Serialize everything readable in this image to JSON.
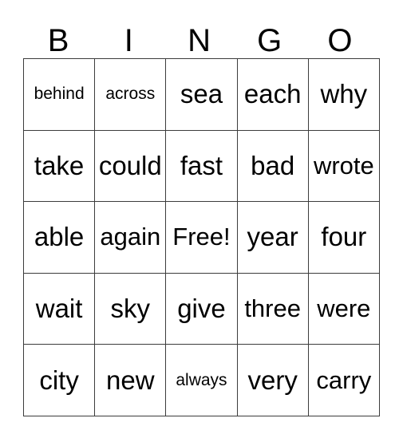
{
  "card": {
    "header_letters": [
      "B",
      "I",
      "N",
      "G",
      "O"
    ],
    "free_space_label": "Free!",
    "rows": [
      [
        {
          "text": "behind",
          "size": "small"
        },
        {
          "text": "across",
          "size": "small"
        },
        {
          "text": "sea",
          "size": "normal"
        },
        {
          "text": "each",
          "size": "normal"
        },
        {
          "text": "why",
          "size": "normal"
        }
      ],
      [
        {
          "text": "take",
          "size": "normal"
        },
        {
          "text": "could",
          "size": "normal"
        },
        {
          "text": "fast",
          "size": "normal"
        },
        {
          "text": "bad",
          "size": "normal"
        },
        {
          "text": "wrote",
          "size": "tight"
        }
      ],
      [
        {
          "text": "able",
          "size": "normal"
        },
        {
          "text": "again",
          "size": "tight"
        },
        {
          "text": "Free!",
          "size": "tight"
        },
        {
          "text": "year",
          "size": "normal"
        },
        {
          "text": "four",
          "size": "normal"
        }
      ],
      [
        {
          "text": "wait",
          "size": "normal"
        },
        {
          "text": "sky",
          "size": "normal"
        },
        {
          "text": "give",
          "size": "normal"
        },
        {
          "text": "three",
          "size": "tight"
        },
        {
          "text": "were",
          "size": "tight"
        }
      ],
      [
        {
          "text": "city",
          "size": "normal"
        },
        {
          "text": "new",
          "size": "normal"
        },
        {
          "text": "always",
          "size": "small"
        },
        {
          "text": "very",
          "size": "normal"
        },
        {
          "text": "carry",
          "size": "tight"
        }
      ]
    ]
  },
  "colors": {
    "background": "#ffffff",
    "text": "#000000",
    "grid_line": "#3c3c3c"
  }
}
